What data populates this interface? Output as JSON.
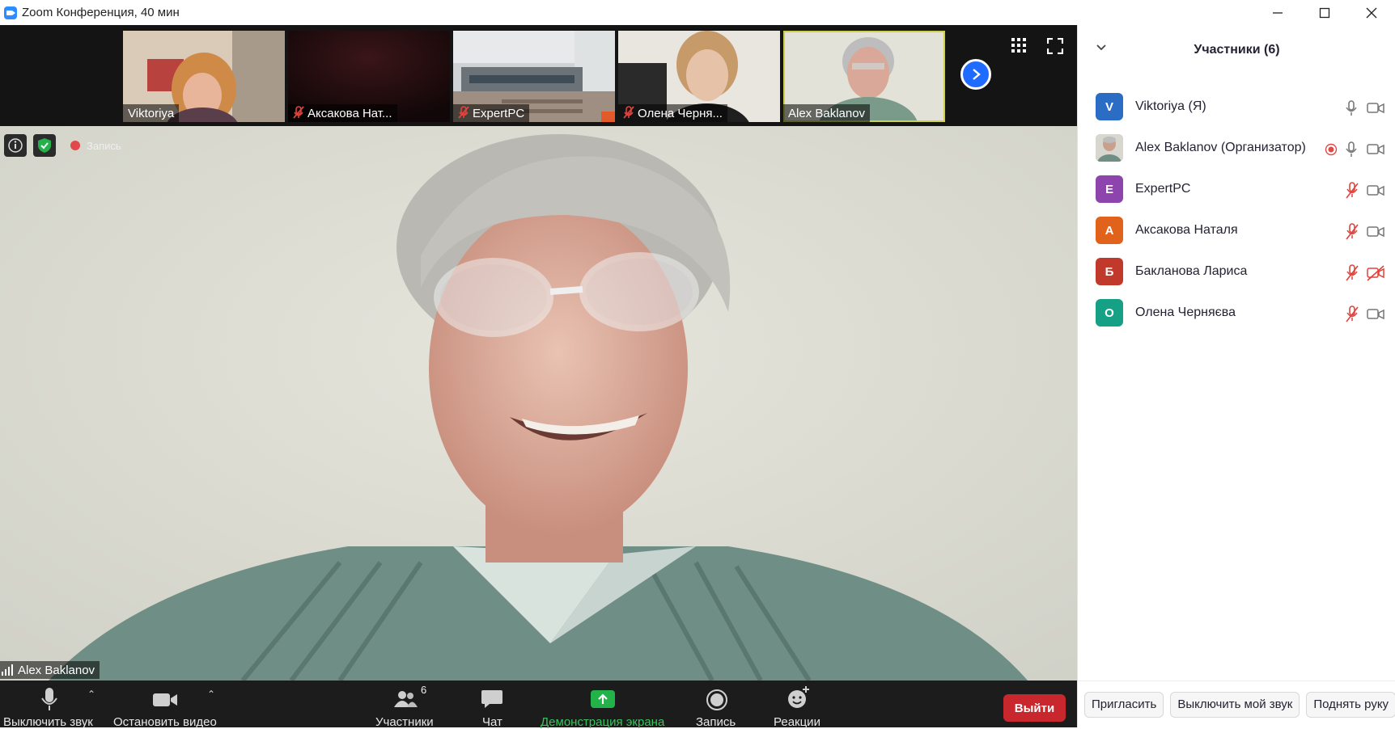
{
  "window": {
    "title": "Zoom Конференция, 40 мин",
    "controls": [
      "minimize",
      "maximize",
      "close"
    ]
  },
  "thumbnails": [
    {
      "name": "Viktoriya",
      "muted": false,
      "active": false
    },
    {
      "name": "Аксакова Нат...",
      "muted": true,
      "active": false
    },
    {
      "name": "ExpertPC",
      "muted": true,
      "active": false
    },
    {
      "name": "Олена Черня...",
      "muted": true,
      "active": false
    },
    {
      "name": "Alex Baklanov",
      "muted": false,
      "active": true
    }
  ],
  "main_video": {
    "speaker_name": "Alex Baklanov",
    "recording_label": "Запись"
  },
  "toolbar": {
    "mute_label": "Выключить звук",
    "video_label": "Остановить видео",
    "participants_label": "Участники",
    "participants_count": "6",
    "chat_label": "Чат",
    "share_label": "Демонстрация экрана",
    "record_label": "Запись",
    "reactions_label": "Реакции",
    "leave_label": "Выйти"
  },
  "panel": {
    "title": "Участники (6)",
    "participants": [
      {
        "initial": "V",
        "name": "Viktoriya (Я)",
        "color": "#2b6cc4",
        "mic": "on",
        "video": "on",
        "rec": false
      },
      {
        "initial": "",
        "name": "Alex Baklanov (Организатор)",
        "color": "#888888",
        "mic": "on",
        "video": "on",
        "rec": true
      },
      {
        "initial": "E",
        "name": "ExpertPC",
        "color": "#8e44ad",
        "mic": "off",
        "video": "on",
        "rec": false
      },
      {
        "initial": "А",
        "name": "Аксакова Наталя",
        "color": "#e0621b",
        "mic": "off",
        "video": "on",
        "rec": false
      },
      {
        "initial": "Б",
        "name": "Бакланова Лариса",
        "color": "#c0392b",
        "mic": "off",
        "video": "off",
        "rec": false
      },
      {
        "initial": "О",
        "name": "Олена Черняєва",
        "color": "#16a085",
        "mic": "off",
        "video": "on",
        "rec": false
      }
    ],
    "footer": {
      "invite_label": "Пригласить",
      "mute_me_label": "Выключить мой звук",
      "raise_hand_label": "Поднять руку"
    }
  },
  "colors": {
    "accent_blue": "#2d8cff",
    "leave_red": "#c7272d",
    "share_green": "#23b24a",
    "muted_red": "#e0433c"
  }
}
